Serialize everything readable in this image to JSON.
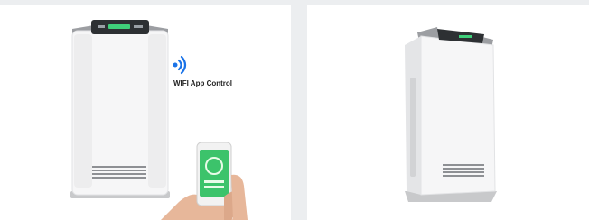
{
  "gallery": {
    "left_product": {
      "feature_label": "WIFI App Control",
      "icon": "wifi-icon"
    },
    "right_product": {
      "icon": "air-purifier-side-view"
    },
    "phone": {
      "screen_color": "#3cc36b"
    }
  }
}
